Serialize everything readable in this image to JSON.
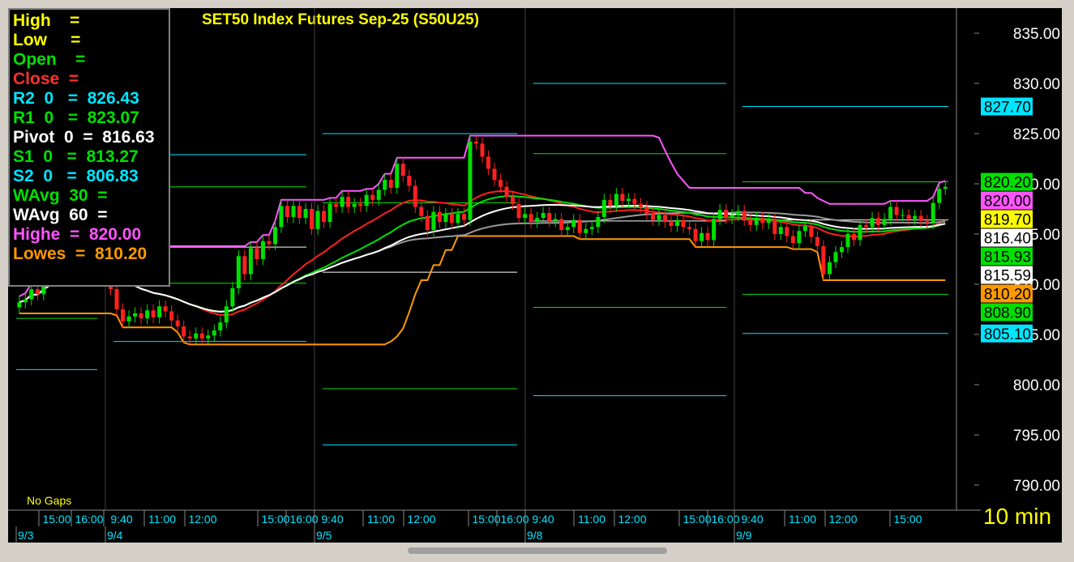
{
  "title": "SET50  Index  Futures  Sep-25  (S50U25)",
  "timeframe": "10  min",
  "no_gaps": "No  Gaps",
  "info_panel": [
    {
      "label": "High    =",
      "color": "#ffff00"
    },
    {
      "label": "Low     =",
      "color": "#ffff00"
    },
    {
      "label": "Open    =",
      "color": "#00e000"
    },
    {
      "label": "Close  =",
      "color": "#ff3030"
    },
    {
      "label": "R2  0   =  826.43",
      "color": "#00e5ff"
    },
    {
      "label": "R1  0   =  823.07",
      "color": "#00e000"
    },
    {
      "label": "Pivot  0  =  816.63",
      "color": "#ffffff"
    },
    {
      "label": "S1  0   =  813.27",
      "color": "#00e000"
    },
    {
      "label": "S2  0   =  806.83",
      "color": "#00e5ff"
    },
    {
      "label": "WAvg  30  =",
      "color": "#00e000"
    },
    {
      "label": "WAvg  60  =",
      "color": "#ffffff"
    },
    {
      "label": "Highe  =  820.00",
      "color": "#ff55ff"
    },
    {
      "label": "Lowes  =  810.20",
      "color": "#ff9900"
    }
  ],
  "price_tags": [
    {
      "text": "827.70",
      "value": 827.7,
      "bg": "#00e5ff"
    },
    {
      "text": "820.20",
      "value": 820.2,
      "bg": "#00e000"
    },
    {
      "text": "820.00",
      "value": 820.0,
      "bg": "#ff55ff"
    },
    {
      "text": "819.70",
      "value": 819.7,
      "bg": "#ffff00"
    },
    {
      "text": "816.40",
      "value": 816.4,
      "bg": "#ffffff"
    },
    {
      "text": "815.93",
      "value": 815.93,
      "bg": "#00e000"
    },
    {
      "text": "815.59",
      "value": 815.59,
      "bg": "#ffffff"
    },
    {
      "text": "810.20",
      "value": 810.2,
      "bg": "#ff9900"
    },
    {
      "text": "808.90",
      "value": 808.9,
      "bg": "#00e000"
    },
    {
      "text": "805.10",
      "value": 805.1,
      "bg": "#00e5ff"
    }
  ],
  "time_labels": [
    "15:00",
    "16:00",
    "9:40",
    "11:00",
    "12:00",
    "15:00",
    "16:00",
    "9:40",
    "11:00",
    "12:00",
    "15:00",
    "16:00",
    "9:40",
    "11:00",
    "12:00",
    "15:00",
    "16:00",
    "9:40",
    "11:00",
    "12:00",
    "15:00"
  ],
  "date_labels": [
    "9/3",
    "9/4",
    "9/5",
    "9/8",
    "9/9"
  ],
  "colors": {
    "bull": "#00e000",
    "bear": "#ff2020",
    "wavg30": "#00e000",
    "wavg60": "#ffffff",
    "grey_ma": "#9a9a9a",
    "highest": "#ff55ff",
    "lowest": "#ff9900",
    "r2": "#00e5ff",
    "r1": "#00e000",
    "pivot": "#ffffff"
  },
  "chart_data": {
    "type": "candlestick",
    "title": "SET50  Index  Futures  Sep-25  (S50U25)",
    "y_axis": {
      "ticks": [
        "835.00",
        "830.00",
        "825.00",
        "820.00",
        "815.00",
        "810.00",
        "805.00",
        "800.00",
        "795.00",
        "790.00"
      ],
      "tick_values": [
        835,
        830,
        825,
        820,
        815,
        810,
        805,
        800,
        795,
        790
      ],
      "range": [
        787.5,
        837.5
      ],
      "side": "right"
    },
    "sessions": [
      {
        "date": "9/3",
        "R2": 821.2,
        "R1": 814.7,
        "P": 812.2,
        "S1": 806.6,
        "S2": 801.5
      },
      {
        "date": "9/4",
        "R2": 822.9,
        "R1": 819.7,
        "P": 813.7,
        "S1": 810.1,
        "S2": 804.3
      },
      {
        "date": "9/5",
        "R2": 825.0,
        "R1": 818.1,
        "P": 811.2,
        "S1": 799.6,
        "S2": 794.0
      },
      {
        "date": "9/8",
        "R2": 830.0,
        "R1": 823.0,
        "P": 816.3,
        "S1": 807.7,
        "S2": 798.9
      },
      {
        "date": "9/9",
        "R2": 827.7,
        "R1": 820.2,
        "P": 816.4,
        "S1": 809.0,
        "S2": 805.1
      }
    ],
    "close": [
      808.2,
      808.5,
      809.5,
      809.0,
      810.5,
      810.9,
      811.5,
      812.0,
      812.5,
      811.5,
      813.2,
      812.9,
      812.6,
      811.8,
      810.8,
      809.5,
      807.5,
      806.3,
      806.8,
      807.1,
      806.6,
      807.4,
      806.7,
      807.8,
      807.3,
      806.4,
      805.8,
      804.8,
      804.6,
      805.1,
      804.6,
      804.9,
      805.4,
      806.2,
      807.8,
      809.6,
      812.8,
      811.0,
      813.6,
      812.5,
      814.3,
      814.0,
      815.7,
      817.8,
      816.7,
      817.8,
      816.6,
      817.5,
      815.5,
      817.3,
      816.2,
      818.0,
      817.7,
      818.7,
      817.7,
      818.0,
      817.8,
      818.9,
      818.4,
      819.4,
      820.4,
      819.6,
      822.0,
      820.8,
      819.8,
      817.7,
      816.8,
      815.4,
      817.2,
      816.2,
      817.0,
      816.1,
      817.0,
      816.4,
      824.2,
      824.0,
      822.7,
      821.5,
      820.4,
      819.7,
      818.7,
      818.0,
      816.6,
      817.0,
      816.2,
      816.6,
      817.1,
      816.3,
      816.5,
      815.4,
      815.7,
      816.4,
      815.1,
      815.5,
      815.7,
      816.7,
      818.4,
      817.8,
      819.0,
      818.3,
      818.5,
      818.0,
      817.7,
      817.0,
      816.4,
      816.9,
      816.2,
      815.8,
      816.4,
      815.7,
      815.5,
      814.3,
      815.1,
      814.4,
      816.5,
      817.4,
      816.6,
      816.9,
      817.3,
      816.4,
      815.9,
      816.6,
      816.1,
      816.4,
      815.0,
      815.7,
      814.8,
      814.1,
      815.3,
      815.8,
      814.7,
      813.8,
      811.0,
      812.2,
      813.2,
      813.7,
      815.0,
      814.4,
      815.9,
      815.7,
      816.6,
      815.9,
      816.5,
      817.7,
      816.9,
      816.9,
      816.5,
      816.8,
      816.3,
      816.1,
      818.1,
      819.5,
      819.7
    ],
    "wavg30_end": 815.93,
    "wavg60_end": 815.59,
    "highest_end": 820.0,
    "lowest_end": 810.2
  }
}
